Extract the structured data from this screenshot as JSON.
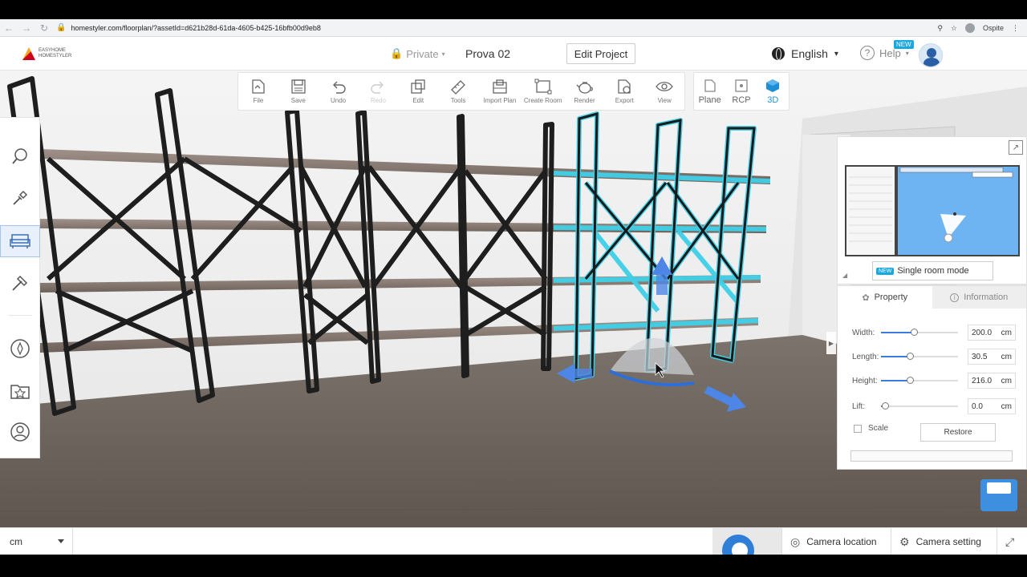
{
  "browser": {
    "url": "homestyler.com/floorplan/?assetId=d621b28d-61da-4605-b425-16bfb00d9eb8",
    "profile": "Ospite"
  },
  "header": {
    "logo_text": "EASYHOME HOMESTYLER",
    "privacy": "Private",
    "project_name": "Prova 02",
    "edit_project": "Edit Project",
    "language": "English",
    "help": "Help",
    "new_badge": "NEW"
  },
  "toolbar": {
    "items": [
      {
        "label": "File",
        "icon": "file-icon"
      },
      {
        "label": "Save",
        "icon": "save-icon"
      },
      {
        "label": "Undo",
        "icon": "undo-icon"
      },
      {
        "label": "Redo",
        "icon": "redo-icon"
      },
      {
        "label": "Edit",
        "icon": "edit-icon"
      },
      {
        "label": "Tools",
        "icon": "ruler-icon"
      },
      {
        "label": "Import Plan",
        "icon": "import-plan-icon"
      },
      {
        "label": "Create Room",
        "icon": "create-room-icon"
      },
      {
        "label": "Render",
        "icon": "teapot-icon"
      },
      {
        "label": "Export",
        "icon": "export-icon"
      },
      {
        "label": "View",
        "icon": "eye-icon"
      }
    ],
    "modes": [
      {
        "label": "Plane"
      },
      {
        "label": "RCP"
      },
      {
        "label": "3D"
      }
    ]
  },
  "sidebar": {
    "items": [
      "search-icon",
      "shovel-icon",
      "furniture-icon",
      "hammer-icon",
      "compass-icon",
      "star-box-icon",
      "user-icon"
    ]
  },
  "minimap": {
    "new_badge": "NEW",
    "single_room": "Single room mode"
  },
  "properties": {
    "tab_property": "Property",
    "tab_information": "Information",
    "width": {
      "label": "Width:",
      "value": "200.0",
      "unit": "cm",
      "level": 0.43
    },
    "length": {
      "label": "Length:",
      "value": "30.5",
      "unit": "cm",
      "level": 0.37
    },
    "height": {
      "label": "Height:",
      "value": "216.0",
      "unit": "cm",
      "level": 0.37
    },
    "lift": {
      "label": "Lift:",
      "value": "0.0",
      "unit": "cm",
      "level": 0.05
    },
    "scale": "Scale",
    "restore": "Restore"
  },
  "status": {
    "unit": "cm",
    "camera_location": "Camera location",
    "camera_setting": "Camera setting"
  },
  "colors": {
    "accent": "#1e8fd6",
    "selection": "#3fd0e8",
    "floor": "#6e655d"
  }
}
